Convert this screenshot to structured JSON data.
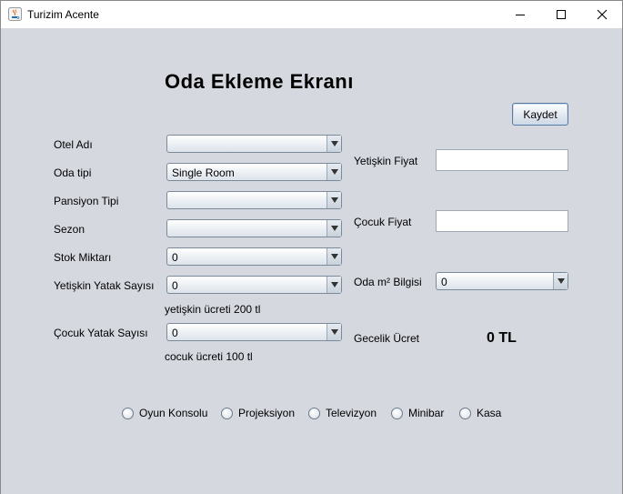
{
  "window": {
    "title": "Turizim Acente"
  },
  "heading": "Oda Ekleme Ekranı",
  "buttons": {
    "save": "Kaydet"
  },
  "left_form": {
    "otel_adi": {
      "label": "Otel Adı",
      "value": ""
    },
    "oda_tipi": {
      "label": "Oda tipi",
      "value": "Single Room"
    },
    "pansiyon_tipi": {
      "label": "Pansiyon Tipi",
      "value": ""
    },
    "sezon": {
      "label": "Sezon",
      "value": ""
    },
    "stok": {
      "label": "Stok Miktarı",
      "value": "0"
    },
    "yetiskin_yatak": {
      "label": "Yetişkin Yatak Sayısı",
      "value": "0",
      "note": "yetişkin ücreti 200 tl"
    },
    "cocuk_yatak": {
      "label": "Çocuk Yatak Sayısı",
      "value": "0",
      "note": "cocuk ücreti 100 tl"
    }
  },
  "right_form": {
    "yetiskin_fiyat": {
      "label": "Yetişkin Fiyat",
      "value": ""
    },
    "cocuk_fiyat": {
      "label": "Çocuk Fiyat",
      "value": ""
    },
    "oda_m2": {
      "label": "Oda m² Bilgisi",
      "value": "0"
    },
    "gecelik": {
      "label": "Gecelik Ücret",
      "value": "0 TL"
    }
  },
  "features": [
    "Oyun Konsolu",
    "Projeksiyon",
    "Televizyon",
    "Minibar",
    "Kasa"
  ]
}
